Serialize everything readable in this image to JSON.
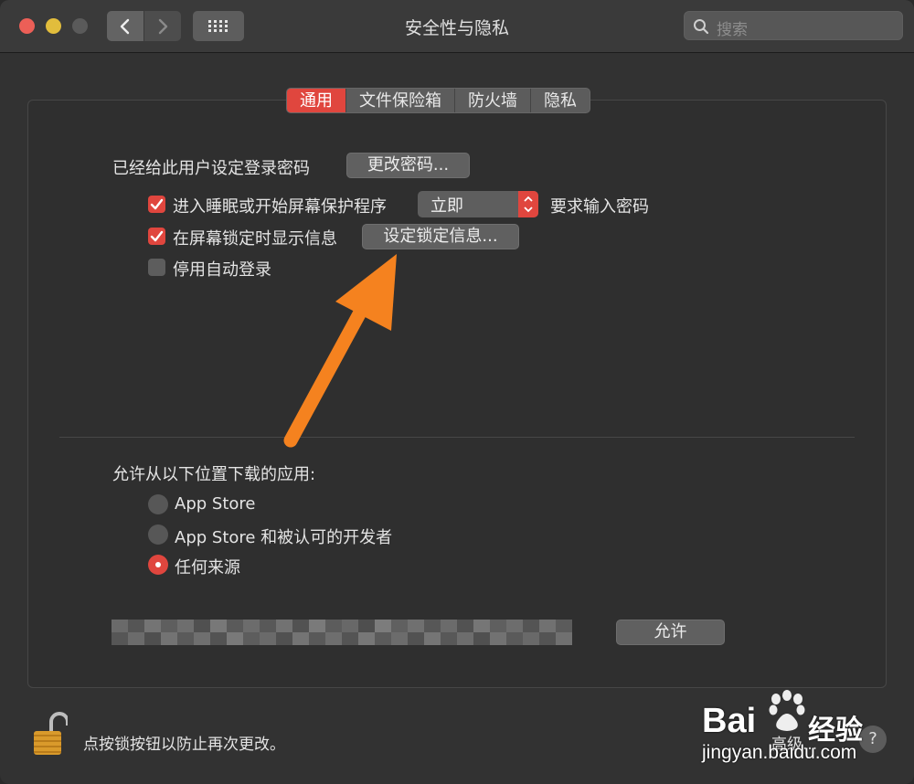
{
  "window": {
    "title": "安全性与隐私",
    "search_placeholder": "搜索"
  },
  "tabs": [
    {
      "label": "通用",
      "active": true
    },
    {
      "label": "文件保险箱",
      "active": false
    },
    {
      "label": "防火墙",
      "active": false
    },
    {
      "label": "隐私",
      "active": false
    }
  ],
  "general": {
    "password_label": "已经给此用户设定登录密码",
    "change_password_button": "更改密码...",
    "require_password": {
      "checked": true,
      "label": "进入睡眠或开始屏幕保护程序",
      "select_value": "立即",
      "suffix": "要求输入密码"
    },
    "show_message": {
      "checked": true,
      "label": "在屏幕锁定时显示信息",
      "button": "设定锁定信息..."
    },
    "disable_auto_login": {
      "checked": false,
      "label": "停用自动登录"
    }
  },
  "downloads": {
    "heading": "允许从以下位置下载的应用:",
    "options": [
      {
        "label": "App Store",
        "selected": false
      },
      {
        "label": "App Store 和被认可的开发者",
        "selected": false
      },
      {
        "label": "任何来源",
        "selected": true
      }
    ],
    "allow_button": "允许"
  },
  "footer": {
    "lock_text": "点按锁按钮以防止再次更改。",
    "advanced_button": "高级...",
    "help": "?"
  },
  "watermark": {
    "brand": "Bai",
    "brand2": "经验",
    "url": "jingyan.baidu.com"
  },
  "colors": {
    "accent": "#e0463e",
    "arrow": "#f5821f"
  },
  "icons": [
    "chevron-left-icon",
    "chevron-right-icon",
    "grid-icon",
    "search-icon",
    "checkmark-icon",
    "stepper-icon",
    "unlocked-padlock-icon",
    "help-icon"
  ]
}
